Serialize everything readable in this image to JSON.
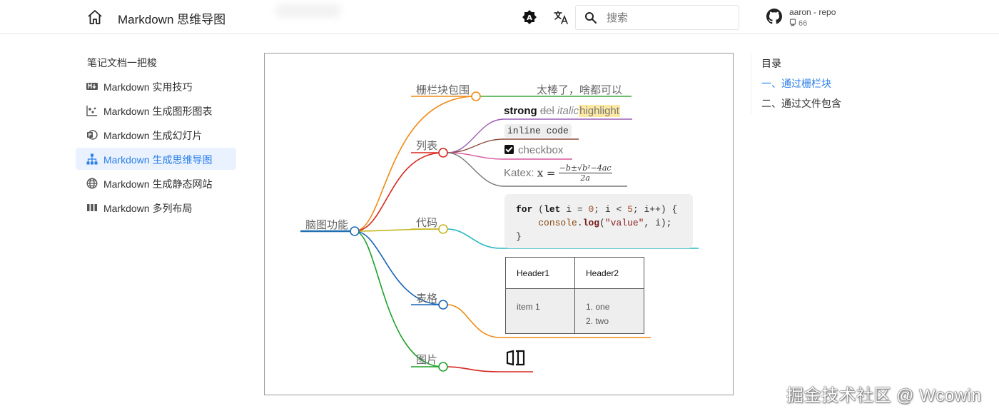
{
  "header": {
    "title": "Markdown 思维导图",
    "search_placeholder": "搜索",
    "repo_name": "aaron - repo",
    "repo_stars": "66",
    "icons": [
      "home-icon",
      "theme-toggle-icon",
      "translate-icon",
      "search-icon",
      "github-icon",
      "star-icon"
    ]
  },
  "sidebar": {
    "title": "笔记文档一把梭",
    "items": [
      {
        "label": "Markdown 实用技巧",
        "icon": "markdown-icon"
      },
      {
        "label": "Markdown 生成图形图表",
        "icon": "chart-icon"
      },
      {
        "label": "Markdown 生成幻灯片",
        "icon": "slides-icon"
      },
      {
        "label": "Markdown 生成思维导图",
        "icon": "sitemap-icon",
        "active": true
      },
      {
        "label": "Markdown 生成静态网站",
        "icon": "globe-icon"
      },
      {
        "label": "Markdown 多列布局",
        "icon": "columns-icon"
      }
    ]
  },
  "mindmap": {
    "root": "脑图功能",
    "branches": {
      "fence": {
        "label": "栅栏块包围",
        "leaf": "太棒了，啥都可以"
      },
      "list": {
        "label": "列表",
        "strong": "strong",
        "del": "del",
        "italic": "italic",
        "highlight": "highlight",
        "inline_code": "inline code",
        "checkbox": "checkbox",
        "katex_label": "Katex:",
        "katex_lhs": "x =",
        "katex_num": "−b±√b²−4ac",
        "katex_den": "2a"
      },
      "code": {
        "label": "代码",
        "kw_for": "for",
        "kw_let": "let",
        "var_i": "i",
        "num_0": "0",
        "num_5": "5",
        "obj": "console",
        "fn": "log",
        "str": "\"value\""
      },
      "table": {
        "label": "表格",
        "headers": [
          "Header1",
          "Header2"
        ],
        "row": [
          "item 1",
          "1. one",
          "2. two"
        ]
      },
      "image": {
        "label": "图片",
        "icon": "image-icon"
      }
    },
    "colors": {
      "root": "#1f6fb2",
      "fence": "#ef8a17",
      "list": "#d7261e",
      "code": "#c5b521",
      "table": "#1865b5",
      "image": "#1ea12a"
    }
  },
  "toc": {
    "title": "目录",
    "items": [
      {
        "label": "一、通过栅栏块",
        "active": true
      },
      {
        "label": "二、通过文件包含",
        "active": false
      }
    ]
  },
  "watermark": "掘金技术社区 @ Wcowin"
}
